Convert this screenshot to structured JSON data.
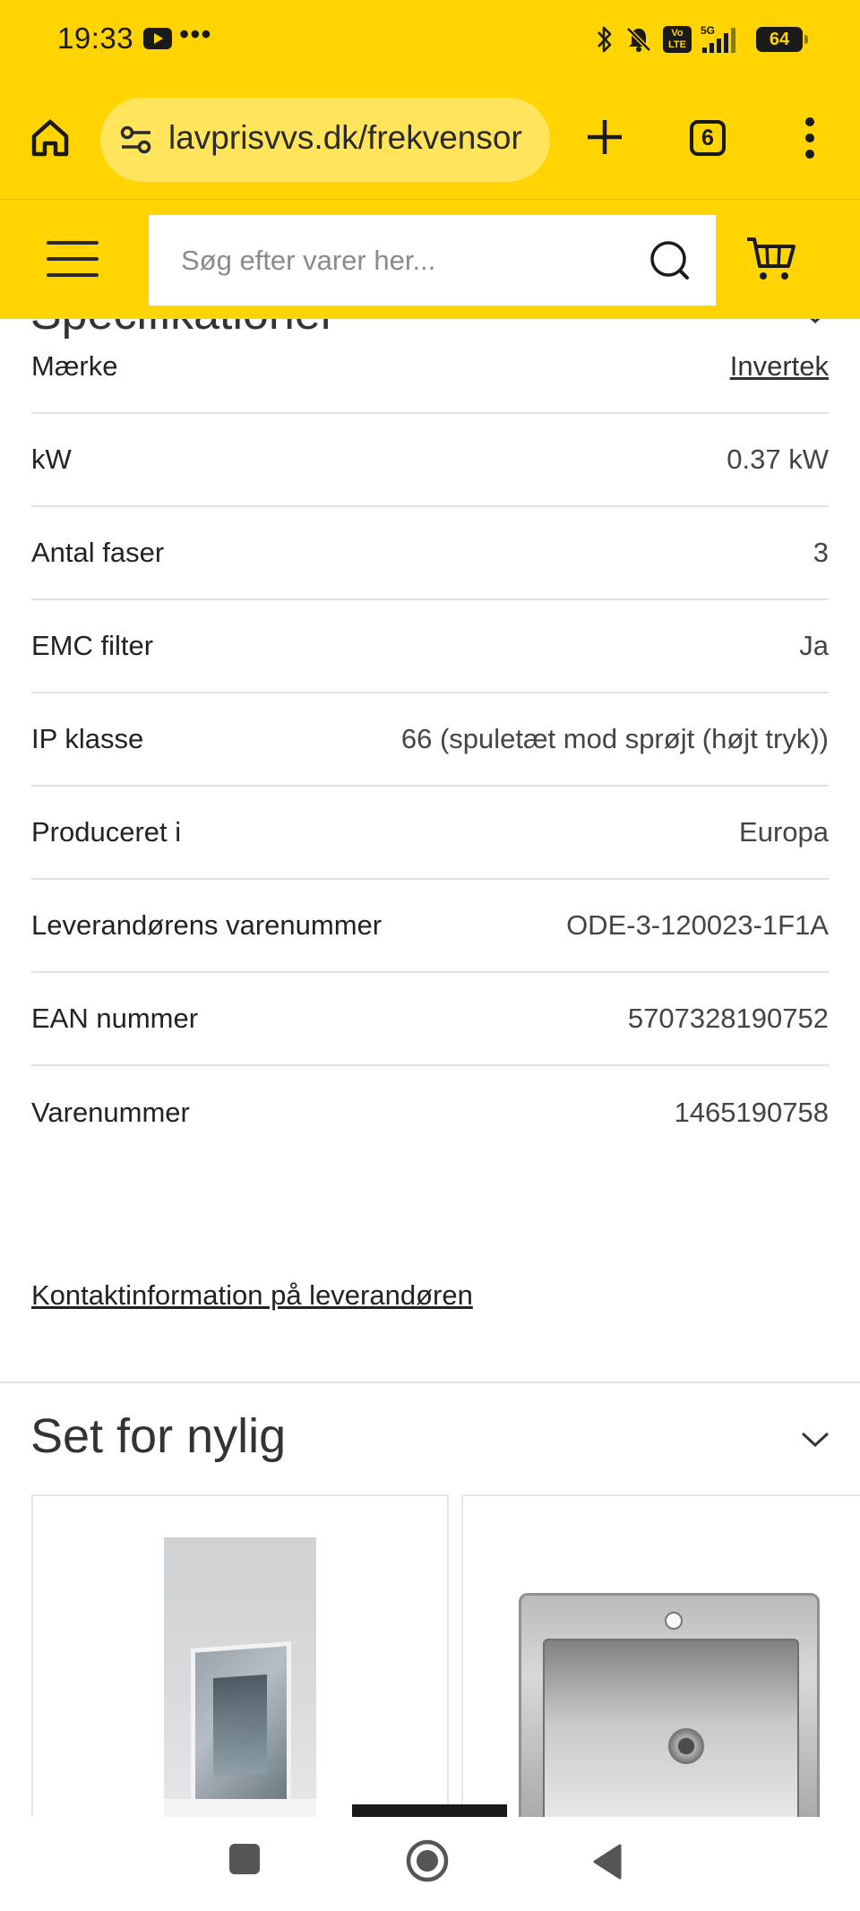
{
  "status_bar": {
    "time": "19:33",
    "more_indicator": "•••",
    "network": "5G",
    "volte_label": "Vo LTE",
    "battery": "64"
  },
  "browser": {
    "url": "lavprisvvs.dk/frekvensor",
    "tab_count": "6"
  },
  "header": {
    "search_placeholder": "Søg efter varer her..."
  },
  "specs": {
    "title": "Specifikationer",
    "rows": [
      {
        "label": "Mærke",
        "value": "Invertek"
      },
      {
        "label": "kW",
        "value": "0.37 kW"
      },
      {
        "label": "Antal faser",
        "value": "3"
      },
      {
        "label": "EMC filter",
        "value": "Ja"
      },
      {
        "label": "IP klasse",
        "value": "66 (spuletæt mod sprøjt (højt tryk))"
      },
      {
        "label": "Produceret i",
        "value": "Europa"
      },
      {
        "label": "Leverandørens varenummer",
        "value": "ODE-3-120023-1F1A"
      },
      {
        "label": "EAN nummer",
        "value": "5707328190752"
      },
      {
        "label": "Varenummer",
        "value": "1465190758"
      }
    ],
    "contact_link": "Kontaktinformation på leverandøren"
  },
  "recently_viewed": {
    "title": "Set for nylig"
  },
  "colors": {
    "brand_yellow": "#ffd400",
    "url_pill": "#ffe45c",
    "text": "#222222",
    "divider": "#e2e2e2"
  },
  "icons": [
    "home-icon",
    "site-settings-icon",
    "plus-icon",
    "tabs-icon",
    "more-vert-icon",
    "hamburger-icon",
    "search-icon",
    "cart-icon",
    "chevron-down-icon",
    "nav-recents-icon",
    "nav-home-icon",
    "nav-back-icon"
  ]
}
